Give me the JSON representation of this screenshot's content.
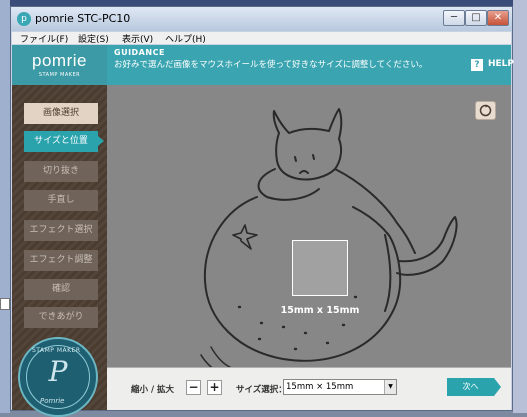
{
  "window": {
    "title": "pomrie STC-PC10",
    "app_icon": "pomrie-app-icon",
    "controls": {
      "minimize": "─",
      "maximize": "□",
      "close": "✕"
    }
  },
  "menu": [
    "ファイル(F)",
    "設定(S)",
    "表示(V)",
    "ヘルプ(H)"
  ],
  "brand": {
    "name": "pomrie",
    "sub": "STAMP MAKER"
  },
  "steps": [
    {
      "label": "画像選択",
      "state": "done"
    },
    {
      "label": "サイズと位置",
      "state": "active"
    },
    {
      "label": "切り抜き",
      "state": "inactive"
    },
    {
      "label": "手直し",
      "state": "inactive"
    },
    {
      "label": "エフェクト選択",
      "state": "inactive"
    },
    {
      "label": "エフェクト調整",
      "state": "inactive"
    },
    {
      "label": "確認",
      "state": "inactive"
    },
    {
      "label": "できあがり",
      "state": "inactive"
    }
  ],
  "guidance": {
    "title": "GUIDANCE",
    "text": "お好みで選んだ画像をマウスホイールを使って好きなサイズに調整してください。",
    "help_icon": "?",
    "help": "HELP"
  },
  "canvas": {
    "size_label": "15mm x 15mm",
    "reset_icon": "reset-icon"
  },
  "bottom": {
    "zoom_label": "縮小 / 拡大",
    "minus": "−",
    "plus": "+",
    "size_select_label": "サイズ選択：",
    "size_value": "15mm × 15mm",
    "next": "次へ"
  },
  "colors": {
    "accent": "#2aa3ad",
    "sidebar": "#4b3c30",
    "canvas": "#878787"
  }
}
